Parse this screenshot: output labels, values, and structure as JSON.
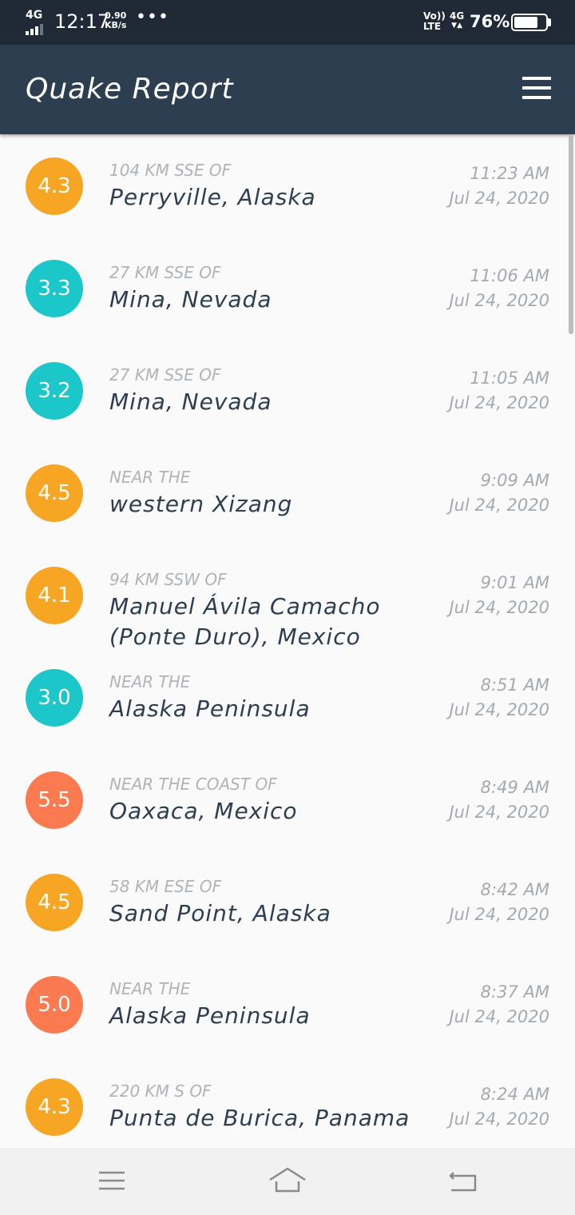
{
  "status_bar": {
    "network": "4G",
    "time": "12:17",
    "speed_value": "0.90",
    "speed_unit": "KB/s",
    "more": "•••",
    "volte_top": "Vo))",
    "volte_bottom": "LTE",
    "network_right": "4G",
    "battery_percent": "76%",
    "battery_level": 0.76
  },
  "app_bar": {
    "title": "Quake Report",
    "menu_icon": "hamburger-menu-icon"
  },
  "colors": {
    "status_bar": "#1f2a36",
    "app_bar": "#2c3e50",
    "mag_3": "#1cc7c9",
    "mag_4": "#f6a623",
    "mag_5": "#fb7a4f"
  },
  "earthquakes": [
    {
      "mag": "4.3",
      "offset": "104 KM SSE OF",
      "primary": "Perryville, Alaska",
      "time": "11:23 AM",
      "date": "Jul 24, 2020"
    },
    {
      "mag": "3.3",
      "offset": "27 KM SSE OF",
      "primary": "Mina, Nevada",
      "time": "11:06 AM",
      "date": "Jul 24, 2020"
    },
    {
      "mag": "3.2",
      "offset": "27 KM SSE OF",
      "primary": "Mina, Nevada",
      "time": "11:05 AM",
      "date": "Jul 24, 2020"
    },
    {
      "mag": "4.5",
      "offset": "NEAR THE",
      "primary": "western Xizang",
      "time": "9:09 AM",
      "date": "Jul 24, 2020"
    },
    {
      "mag": "4.1",
      "offset": "94 KM SSW OF",
      "primary": "Manuel Ávila Camacho (Ponte Duro), Mexico",
      "time": "9:01 AM",
      "date": "Jul 24, 2020"
    },
    {
      "mag": "3.0",
      "offset": "NEAR THE",
      "primary": "Alaska Peninsula",
      "time": "8:51 AM",
      "date": "Jul 24, 2020"
    },
    {
      "mag": "5.5",
      "offset": "NEAR THE COAST OF",
      "primary": "Oaxaca, Mexico",
      "time": "8:49 AM",
      "date": "Jul 24, 2020"
    },
    {
      "mag": "4.5",
      "offset": "58 KM ESE OF",
      "primary": "Sand Point, Alaska",
      "time": "8:42 AM",
      "date": "Jul 24, 2020"
    },
    {
      "mag": "5.0",
      "offset": "NEAR THE",
      "primary": "Alaska Peninsula",
      "time": "8:37 AM",
      "date": "Jul 24, 2020"
    },
    {
      "mag": "4.3",
      "offset": "220 KM S OF",
      "primary": "Punta de Burica, Panama",
      "time": "8:24 AM",
      "date": "Jul 24, 2020"
    }
  ],
  "nav_bar": {
    "menu_icon": "menu-lines-icon",
    "home_icon": "home-icon",
    "back_icon": "back-icon"
  }
}
